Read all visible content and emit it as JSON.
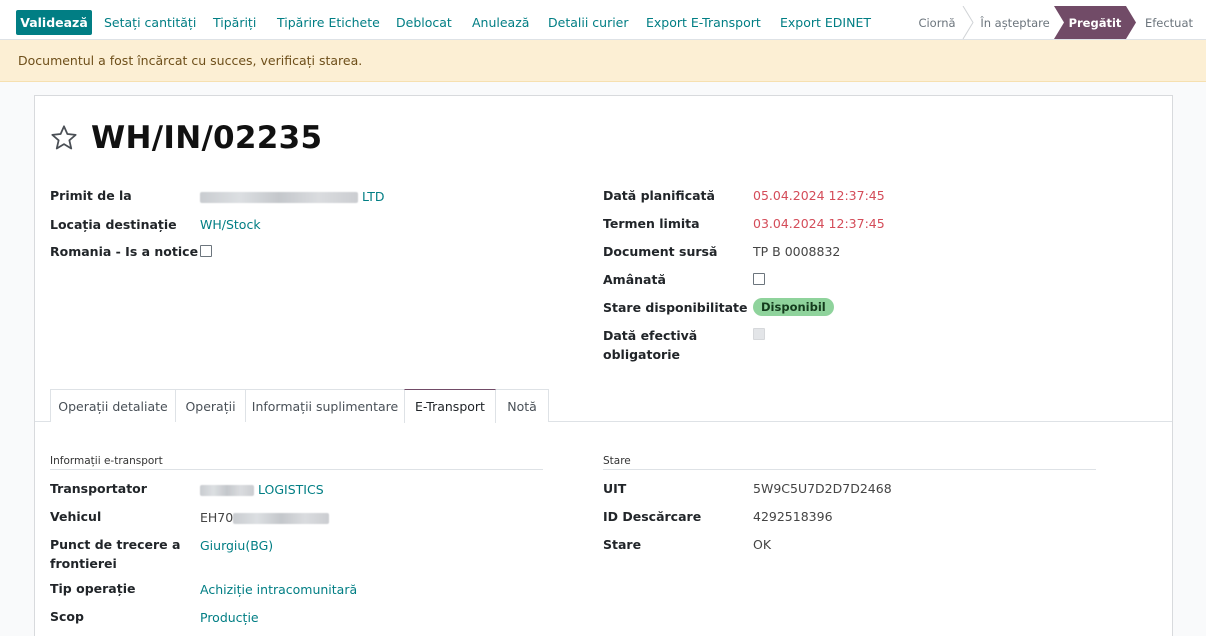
{
  "toolbar": {
    "validate_label": "Validează",
    "buttons": [
      "Setați cantități",
      "Tipăriți",
      "Tipărire Etichete",
      "Deblocat",
      "Anulează",
      "Detalii curier",
      "Export E-Transport",
      "Export EDINET"
    ]
  },
  "statusbar": {
    "stages": [
      "Ciornă",
      "În așteptare",
      "Pregătit",
      "Efectuat"
    ],
    "active": "Pregătit"
  },
  "alert": {
    "message": "Documentul a fost încărcat cu succes, verificați starea."
  },
  "record": {
    "title": "WH/IN/02235",
    "left_fields": {
      "received_from_label": "Primit de la",
      "received_from_suffix": "LTD",
      "dest_location_label": "Locația destinație",
      "dest_location_value": "WH/Stock",
      "romania_notice_label": "Romania - Is a notice"
    },
    "right_fields": {
      "scheduled_date_label": "Dată planificată",
      "scheduled_date_value": "05.04.2024 12:37:45",
      "deadline_label": "Termen limita",
      "deadline_value": "03.04.2024 12:37:45",
      "source_doc_label": "Document sursă",
      "source_doc_value": "TP B 0008832",
      "postponed_label": "Amânată",
      "availability_label": "Stare disponibilitate",
      "availability_value": "Disponibil",
      "effective_date_label_1": "Dată efectivă",
      "effective_date_label_2": "obligatorie"
    }
  },
  "tabs": [
    "Operații detaliate",
    "Operații",
    "Informații suplimentare",
    "E-Transport",
    "Notă"
  ],
  "active_tab": "E-Transport",
  "etransport": {
    "left_section_title": "Informații e-transport",
    "carrier_label": "Transportator",
    "carrier_suffix": "LOGISTICS",
    "vehicle_label": "Vehicul",
    "vehicle_prefix": "EH70",
    "border_label_1": "Punct de trecere a",
    "border_label_2": "frontierei",
    "border_value": "Giurgiu(BG)",
    "op_type_label": "Tip operație",
    "op_type_value": "Achiziție intracomunitară",
    "scope_label": "Scop",
    "scope_value": "Producție",
    "right_section_title": "Stare",
    "uit_label": "UIT",
    "uit_value": "5W9C5U7D2D7D2468",
    "download_id_label": "ID Descărcare",
    "download_id_value": "4292518396",
    "status_label": "Stare",
    "status_value": "OK"
  },
  "colors": {
    "primary": "#017e84",
    "status_active": "#714b67",
    "alert_bg": "#fcefd4",
    "date_red": "#d44c59",
    "badge_green": "#8fd39c"
  }
}
